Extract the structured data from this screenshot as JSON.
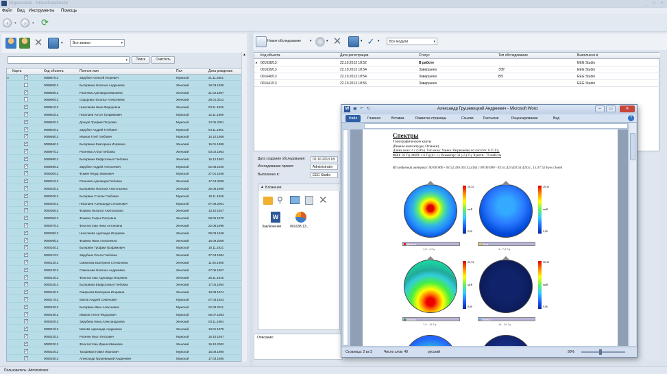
{
  "app": {
    "title": "Organization - NituseDataStudio",
    "window_buttons": [
      "_",
      "□",
      "×"
    ]
  },
  "menu": [
    "Файл",
    "Вид",
    "Инструменты",
    "Помощь"
  ],
  "left_toolbar": {
    "filter_value": "Все записи",
    "search_value": "",
    "search_button": "Поиск",
    "clear_button": "Очистить"
  },
  "patients": {
    "columns": [
      "Карта",
      "Код объекта",
      "Полное имя",
      "Пол",
      "Дата рождения"
    ],
    "rows": [
      {
        "checked": true,
        "code": "008987/13",
        "name": "Зарубин Алексей Игоревич",
        "sex": "Мужской",
        "dob": "21.11.2051"
      },
      {
        "checked": false,
        "code": "008988/13",
        "name": "Быткрвина Наталья Андреевна",
        "sex": "Женский",
        "dob": "19.03.1935"
      },
      {
        "checked": true,
        "code": "008989/13",
        "name": "Рогачева Аделаида Ивановна",
        "sex": "Женский",
        "dob": "21.02.1967"
      },
      {
        "checked": false,
        "code": "008990/13",
        "name": "Сидорова Наталья Алексеевна",
        "sex": "Женский",
        "dob": "28.01.2012"
      },
      {
        "checked": true,
        "code": "008991/13",
        "name": "Николаева Нина Федоровна",
        "sex": "Женский",
        "dob": "03.11.1925"
      },
      {
        "checked": true,
        "code": "008992/13",
        "name": "Николаев Антон Трофимович",
        "sex": "Мужской",
        "dob": "12.11.1969"
      },
      {
        "checked": true,
        "code": "008993/13",
        "name": "Донцов Трофим Петрович",
        "sex": "Мужской",
        "dob": "12.05.2001"
      },
      {
        "checked": true,
        "code": "008994/13",
        "name": "Зарубин Андрей Глебович",
        "sex": "Мужской",
        "dob": "04.11.1961"
      },
      {
        "checked": true,
        "code": "008995/13",
        "name": "Иванов Глеб Глебович",
        "sex": "Мужской",
        "dob": "15.10.1958"
      },
      {
        "checked": true,
        "code": "008996/13",
        "name": "Быткрвина Екатерина Игоревна",
        "sex": "Женский",
        "dob": "15.01.1988"
      },
      {
        "checked": true,
        "code": "008997/13",
        "name": "Рогачева Алла Глебовна",
        "sex": "Женский",
        "dob": "03.02.1963"
      },
      {
        "checked": true,
        "code": "008998/13",
        "name": "Быткрвина Евфросинья Глебовна",
        "sex": "Женский",
        "dob": "16.12.1952"
      },
      {
        "checked": true,
        "code": "008999/13",
        "name": "Зарубин Андрей Алексеевич",
        "sex": "Мужской",
        "dob": "02.08.1920"
      },
      {
        "checked": true,
        "code": "009000/13",
        "name": "Фомин Федор Иванович",
        "sex": "Мужской",
        "dob": "27.01.1948"
      },
      {
        "checked": true,
        "code": "009001/13",
        "name": "Рогачева Аделаида Глебовна",
        "sex": "Женский",
        "dob": "17.04.2009"
      },
      {
        "checked": true,
        "code": "009002/13",
        "name": "Быткрвина Наталья Анатольевна",
        "sex": "Женский",
        "dob": "26.06.1960"
      },
      {
        "checked": true,
        "code": "009003/13",
        "name": "Быткрвин Степан Глебович",
        "sex": "Мужской",
        "dob": "18.11.1938"
      },
      {
        "checked": true,
        "code": "009004/13",
        "name": "Николаев Александр Степанович",
        "sex": "Мужской",
        "dob": "07.09.2001"
      },
      {
        "checked": true,
        "code": "009005/13",
        "name": "Фомина Наталья Анатольевна",
        "sex": "Женский",
        "dob": "13.10.1947"
      },
      {
        "checked": true,
        "code": "009006/13",
        "name": "Фомина Софья Петровна",
        "sex": "Женский",
        "dob": "08.05.1970"
      },
      {
        "checked": true,
        "code": "009007/13",
        "name": "Феоктистова Нина Антоновна",
        "sex": "Женский",
        "dob": "22.08.1996"
      },
      {
        "checked": true,
        "code": "009008/13",
        "name": "Николаева Аделаида Игоревна",
        "sex": "Женский",
        "dob": "09.09.1948"
      },
      {
        "checked": true,
        "code": "009009/13",
        "name": "Фомина Нина Алексеевна",
        "sex": "Женский",
        "dob": "15.09.2008"
      },
      {
        "checked": true,
        "code": "009010/13",
        "name": "Быткрвин Трофим Трофимович",
        "sex": "Мужской",
        "dob": "18.11.1921"
      },
      {
        "checked": true,
        "code": "009011/13",
        "name": "Зарубина Ольга Глебовна",
        "sex": "Женский",
        "dob": "27.04.1984"
      },
      {
        "checked": true,
        "code": "009012/13",
        "name": "Смирнова Екатерина Степановна",
        "sex": "Женский",
        "dob": "11.05.1958"
      },
      {
        "checked": true,
        "code": "009013/13",
        "name": "Савельева Наталья Андреевна",
        "sex": "Женский",
        "dob": "27.05.1957"
      },
      {
        "checked": true,
        "code": "009014/13",
        "name": "Феоктистова Аделаида Игоревна",
        "sex": "Женский",
        "dob": "28.11.1945"
      },
      {
        "checked": true,
        "code": "009015/13",
        "name": "Быткрвина Евфросинья Глебовна",
        "sex": "Женский",
        "dob": "17.04.1994"
      },
      {
        "checked": true,
        "code": "009016/13",
        "name": "Смирнова Екатерина Игоревна",
        "sex": "Женский",
        "dob": "10.09.1974"
      },
      {
        "checked": true,
        "code": "009017/13",
        "name": "Матов Андрей Семенович",
        "sex": "Мужской",
        "dob": "07.03.1923"
      },
      {
        "checked": true,
        "code": "009018/13",
        "name": "Быткрвин-Иван Алексеевич",
        "sex": "Мужской",
        "dob": "22.09.2011"
      },
      {
        "checked": true,
        "code": "009019/13",
        "name": "Иванов Антон Федорович",
        "sex": "Мужской",
        "dob": "06.07.1983"
      },
      {
        "checked": true,
        "code": "009020/13",
        "name": "Зарубина Нина Александровна",
        "sex": "Женский",
        "dob": "03.11.1984"
      },
      {
        "checked": true,
        "code": "009021/13",
        "name": "Матова Аделаида Андреевна",
        "sex": "Женский",
        "dob": "13.01.1975"
      },
      {
        "checked": true,
        "code": "009022/13",
        "name": "Рогачев Фрол Петрович",
        "sex": "Мужской",
        "dob": "16.10.1947"
      },
      {
        "checked": true,
        "code": "009023/13",
        "name": "Феоктистова Ирина Ивановна",
        "sex": "Женский",
        "dob": "15.10.2002"
      },
      {
        "checked": true,
        "code": "009024/13",
        "name": "Трофимов Павел Иванович",
        "sex": "Мужской",
        "dob": "15.08.1980"
      },
      {
        "checked": true,
        "code": "009025/13",
        "name": "Александр Грушевицкий Андреевич",
        "sex": "Мужской",
        "dob": "17.03.1985"
      }
    ]
  },
  "right_toolbar": {
    "new_exam": "Новое обследование",
    "modules_filter": "Все модули"
  },
  "exams": {
    "columns": [
      "Код объекта",
      "Дата регистрации",
      "Статус",
      "Тип обследования",
      "Выполнено в"
    ],
    "rows": [
      {
        "code": "001638/13",
        "date": "22.10.2013 18:52",
        "status": "В работе",
        "type": "",
        "place": "EEG Studio",
        "current": true
      },
      {
        "code": "001639/13",
        "date": "22.10.2013 18:54",
        "status": "Завершено",
        "type": "ЭЭГ",
        "place": "EEG Studio",
        "current": false
      },
      {
        "code": "001640/13",
        "date": "22.10.2013 18:54",
        "status": "Завершено",
        "type": "ВП",
        "place": "EEG Studio",
        "current": false
      },
      {
        "code": "001641/13",
        "date": "22.10.2013 18:56",
        "status": "Завершено",
        "type": "",
        "place": "EEG Studio",
        "current": false
      }
    ]
  },
  "details": {
    "created_label": "Дата создания обследования:",
    "created_value": "02.10.2013 18:",
    "performed_by_label": "Исследование провел:",
    "performed_by_value": "Administrator",
    "done_in_label": "Выполнено в:",
    "done_in_value": "EEG Studio",
    "attachments_header": "Вложения",
    "attachments": [
      "Заключение",
      "001638.13..."
    ],
    "description_label": "Описание:"
  },
  "statusbar": {
    "user": "Пользователь: Administrator"
  },
  "word": {
    "title": "Александр Грушевицкий Андреевич - Microsoft Word",
    "file_tab": "Файл",
    "tabs": [
      "Главная",
      "Вставка",
      "Разметка страницы",
      "Ссылки",
      "Рассылки",
      "Рецензирование",
      "Вид"
    ],
    "doc_heading": "Спектры",
    "doc_sub1": "Топографические карты",
    "doc_sub2": "(Режим амплитуды, Отмоки)",
    "doc_line1": "Длина окна: 4 с (50%). Тип окна: Ханна. Разрешение по частоте: 0.25 Гц.",
    "doc_line2": "ФВЧ: 50 Гц. ФНЧ: 1.6 Гц (0.1 с). Режектор: 50 (±5) Гц. Чувств.: 70 мкВ/см",
    "doc_interval": "Исследуемый интервал: 00:00:000 - 03:52,416 (03:52,416) с 00:00:000 - 03:51,424 (03:51,424) с, 15:37:52 Eyes closed",
    "maps": [
      {
        "band": "Дельта",
        "freq": "1,5 - 4 Гц",
        "top": "26,34",
        "mid": "мкВ",
        "bot": "0,66",
        "swatch": "#e02020"
      },
      {
        "band": "Тета",
        "freq": "4 - 7,5 Гц",
        "top": "26,34",
        "mid": "мкВ",
        "bot": "0,66",
        "swatch": "#f2d41a"
      },
      {
        "band": "Альфа",
        "freq": "7,5 - 14 Гц",
        "top": "26,34",
        "mid": "мкВ",
        "bot": "0,66",
        "swatch": "#30a040"
      },
      {
        "band": "Бета-1",
        "freq": "14 - 20 Гц",
        "top": "26,34",
        "mid": "мкВ",
        "bot": "0,66",
        "swatch": "#59b3ff"
      }
    ],
    "status": {
      "page": "Страница: 2 из 3",
      "words": "Число слов: 49",
      "lang": "русский",
      "zoom": "90%"
    }
  }
}
